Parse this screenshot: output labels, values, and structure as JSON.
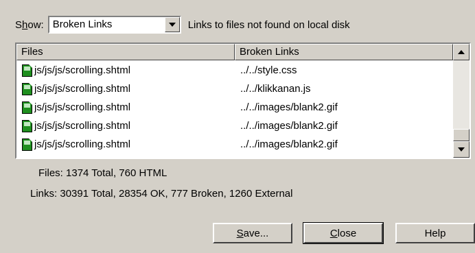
{
  "show": {
    "label_prefix": "S",
    "label_accel": "h",
    "label_suffix": "ow:",
    "value": "Broken Links",
    "description": "Links to files not found on local disk"
  },
  "list": {
    "columns": [
      "Files",
      "Broken Links"
    ],
    "rows": [
      {
        "file": "js/js/js/scrolling.shtml",
        "link": "../../style.css"
      },
      {
        "file": "js/js/js/scrolling.shtml",
        "link": "../../klikkanan.js"
      },
      {
        "file": "js/js/js/scrolling.shtml",
        "link": "../../images/blank2.gif"
      },
      {
        "file": "js/js/js/scrolling.shtml",
        "link": "../../images/blank2.gif"
      },
      {
        "file": "js/js/js/scrolling.shtml",
        "link": "../../images/blank2.gif"
      }
    ]
  },
  "stats": {
    "files": "Files:  1374 Total,  760 HTML",
    "links": "Links:  30391 Total,  28354 OK,  777 Broken,  1260 External"
  },
  "buttons": {
    "save_accel": "S",
    "save_rest": "ave...",
    "close_accel": "C",
    "close_rest": "lose",
    "help": "Help"
  },
  "icons": {
    "file": "html-file-icon",
    "scroll_up": "arrow-up-icon",
    "scroll_down": "arrow-down-icon",
    "dropdown": "chevron-down-icon"
  }
}
